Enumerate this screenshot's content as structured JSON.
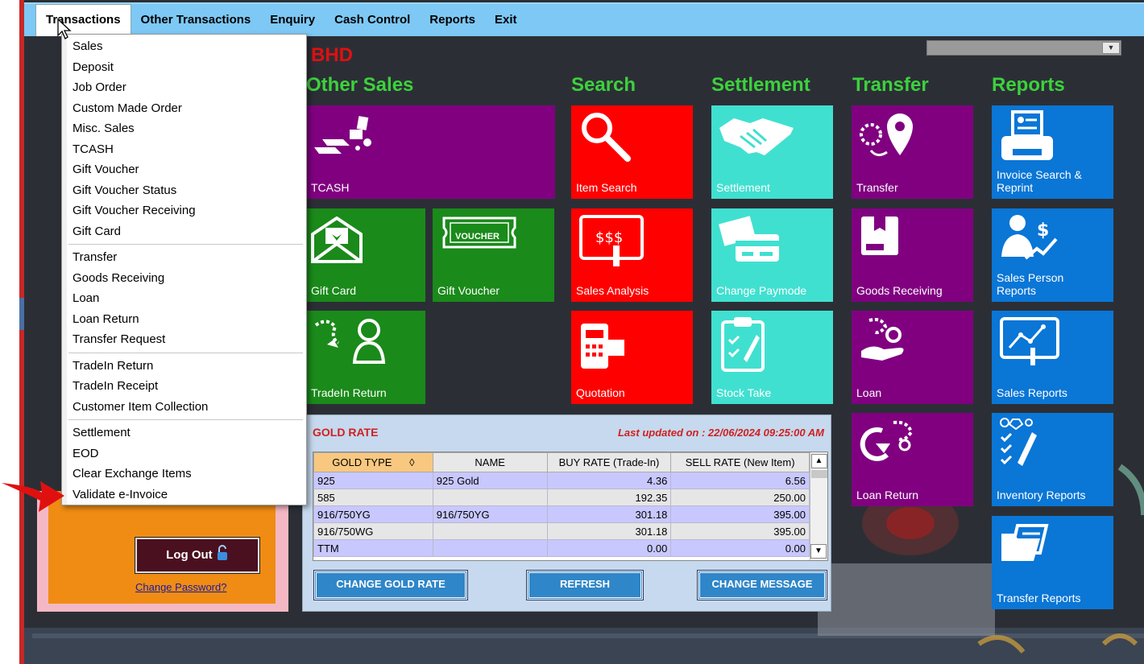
{
  "menubar": {
    "items": [
      "Transactions",
      "Other Transactions",
      "Enquiry",
      "Cash Control",
      "Reports",
      "Exit"
    ]
  },
  "dropdown": {
    "groups": [
      [
        "Sales",
        "Deposit",
        "Job Order",
        "Custom Made Order",
        "Misc. Sales",
        "TCASH",
        "Gift Voucher",
        "Gift Voucher Status",
        "Gift Voucher Receiving",
        "Gift Card"
      ],
      [
        "Transfer",
        "Goods Receiving",
        "Loan",
        "Loan Return",
        "Transfer Request"
      ],
      [
        "TradeIn Return",
        "TradeIn Receipt",
        "Customer Item Collection"
      ],
      [
        "Settlement",
        "EOD",
        "Clear Exchange Items",
        "Validate e-Invoice"
      ]
    ]
  },
  "header": {
    "bhd": "BHD"
  },
  "sections": {
    "other_sales": "Other Sales",
    "search": "Search",
    "settlement": "Settlement",
    "transfer": "Transfer",
    "reports": "Reports"
  },
  "tiles": {
    "tcash": "TCASH",
    "gift_card": "Gift Card",
    "gift_voucher": "Gift Voucher",
    "voucher_art": "VOUCHER",
    "tradein_return": "TradeIn Return",
    "item_search": "Item Search",
    "sales_analysis": "Sales Analysis",
    "quotation": "Quotation",
    "settlement": "Settlement",
    "change_paymode": "Change Paymode",
    "stock_take": "Stock Take",
    "transfer": "Transfer",
    "goods_receiving": "Goods Receiving",
    "loan": "Loan",
    "loan_return": "Loan Return",
    "invoice_search_1": "Invoice Search &",
    "invoice_search_2": "Reprint",
    "sales_person_1": "Sales Person",
    "sales_person_2": "Reports",
    "sales_reports": "Sales Reports",
    "inventory_reports": "Inventory Reports",
    "transfer_reports": "Transfer Reports"
  },
  "gold_rate": {
    "title": "GOLD RATE",
    "updated": "Last updated on : 22/06/2024 09:25:00 AM",
    "columns": [
      "GOLD TYPE",
      "NAME",
      "BUY RATE (Trade-In)",
      "SELL RATE (New Item)"
    ],
    "sort_glyph": "◊",
    "rows": [
      {
        "type": "925",
        "name": "925 Gold",
        "buy": "4.36",
        "sell": "6.56"
      },
      {
        "type": "585",
        "name": "",
        "buy": "192.35",
        "sell": "250.00"
      },
      {
        "type": "916/750YG",
        "name": "916/750YG",
        "buy": "301.18",
        "sell": "395.00"
      },
      {
        "type": "916/750WG",
        "name": "",
        "buy": "301.18",
        "sell": "395.00"
      },
      {
        "type": "TTM",
        "name": "",
        "buy": "0.00",
        "sell": "0.00"
      }
    ],
    "buttons": {
      "change_gold_rate": "CHANGE GOLD RATE",
      "refresh": "REFRESH",
      "change_message": "CHANGE MESSAGE"
    }
  },
  "login": {
    "logout": "Log Out",
    "change_password": "Change Password?"
  },
  "colors": {
    "purple": "#800080",
    "red": "#ff0000",
    "teal": "#40e0d0",
    "green": "#1a8a1a",
    "blue": "#0a76d6",
    "section_green": "#3dd13d",
    "menubar": "#7dc8f5"
  }
}
